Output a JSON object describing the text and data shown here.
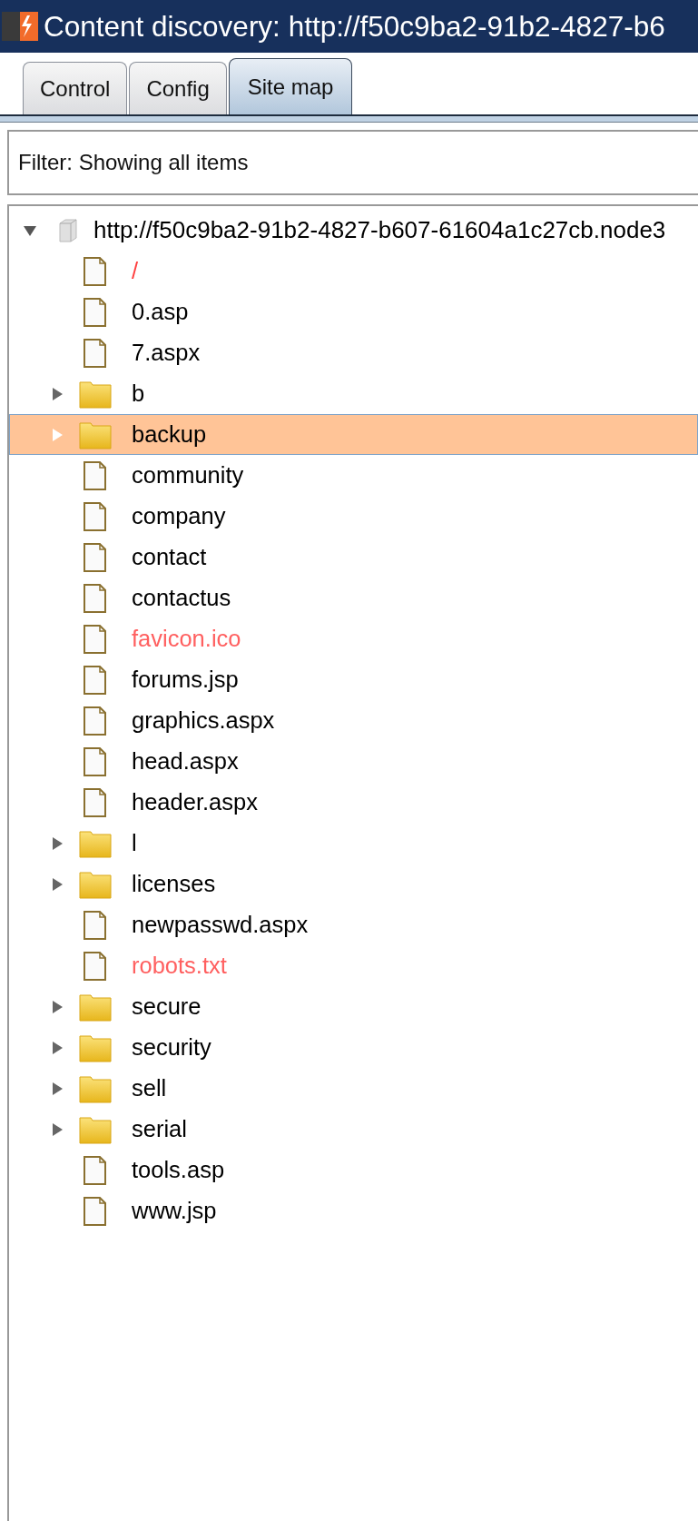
{
  "window": {
    "title": "Content discovery: http://f50c9ba2-91b2-4827-b6"
  },
  "tabs": [
    {
      "label": "Control",
      "selected": false
    },
    {
      "label": "Config",
      "selected": false
    },
    {
      "label": "Site map",
      "selected": true
    }
  ],
  "filter": {
    "text": "Filter: Showing all items"
  },
  "tree": [
    {
      "kind": "host",
      "label": "http://f50c9ba2-91b2-4827-b607-61604a1c27cb.node3",
      "expanded": true,
      "selected": false,
      "children": [
        {
          "kind": "file",
          "label": "/",
          "color": "#ff4040",
          "selected": false
        },
        {
          "kind": "file",
          "label": "0.asp",
          "color": "#000000",
          "selected": false
        },
        {
          "kind": "file",
          "label": "7.aspx",
          "color": "#000000",
          "selected": false
        },
        {
          "kind": "folder",
          "label": "b",
          "color": "#000000",
          "expanded": false,
          "selected": false
        },
        {
          "kind": "folder",
          "label": "backup",
          "color": "#000000",
          "expanded": false,
          "selected": true
        },
        {
          "kind": "file",
          "label": "community",
          "color": "#000000",
          "selected": false
        },
        {
          "kind": "file",
          "label": "company",
          "color": "#000000",
          "selected": false
        },
        {
          "kind": "file",
          "label": "contact",
          "color": "#000000",
          "selected": false
        },
        {
          "kind": "file",
          "label": "contactus",
          "color": "#000000",
          "selected": false
        },
        {
          "kind": "file",
          "label": "favicon.ico",
          "color": "#ff6060",
          "selected": false
        },
        {
          "kind": "file",
          "label": "forums.jsp",
          "color": "#000000",
          "selected": false
        },
        {
          "kind": "file",
          "label": "graphics.aspx",
          "color": "#000000",
          "selected": false
        },
        {
          "kind": "file",
          "label": "head.aspx",
          "color": "#000000",
          "selected": false
        },
        {
          "kind": "file",
          "label": "header.aspx",
          "color": "#000000",
          "selected": false
        },
        {
          "kind": "folder",
          "label": "l",
          "color": "#000000",
          "expanded": false,
          "selected": false
        },
        {
          "kind": "folder",
          "label": "licenses",
          "color": "#000000",
          "expanded": false,
          "selected": false
        },
        {
          "kind": "file",
          "label": "newpasswd.aspx",
          "color": "#000000",
          "selected": false
        },
        {
          "kind": "file",
          "label": "robots.txt",
          "color": "#ff6060",
          "selected": false
        },
        {
          "kind": "folder",
          "label": "secure",
          "color": "#000000",
          "expanded": false,
          "selected": false
        },
        {
          "kind": "folder",
          "label": "security",
          "color": "#000000",
          "expanded": false,
          "selected": false
        },
        {
          "kind": "folder",
          "label": "sell",
          "color": "#000000",
          "expanded": false,
          "selected": false
        },
        {
          "kind": "folder",
          "label": "serial",
          "color": "#000000",
          "expanded": false,
          "selected": false
        },
        {
          "kind": "file",
          "label": "tools.asp",
          "color": "#000000",
          "selected": false
        },
        {
          "kind": "file",
          "label": "www.jsp",
          "color": "#000000",
          "selected": false
        }
      ]
    }
  ]
}
